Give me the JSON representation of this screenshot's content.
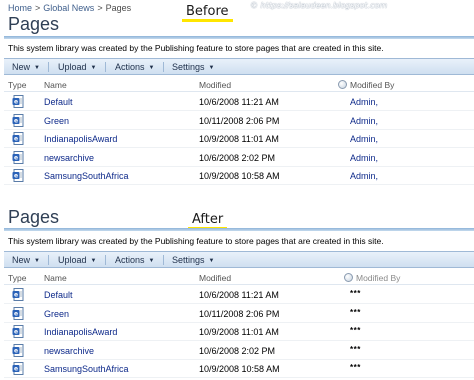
{
  "watermark": "© https://salaudeen.blogspot.com",
  "before": {
    "marker": "Before",
    "breadcrumb": [
      "Home",
      "Global News",
      "Pages"
    ],
    "title": "Pages",
    "description": "This system library was created by the Publishing feature to store pages that are created in this site.",
    "toolbar": {
      "new": "New",
      "upload": "Upload",
      "actions": "Actions",
      "settings": "Settings"
    },
    "columns": {
      "type": "Type",
      "name": "Name",
      "modified": "Modified",
      "modified_by": "Modified By"
    },
    "rows": [
      {
        "name": "Default",
        "modified": "10/6/2008 11:21 AM",
        "modified_by": "Admin,"
      },
      {
        "name": "Green",
        "modified": "10/11/2008 2:06 PM",
        "modified_by": "Admin,"
      },
      {
        "name": "IndianapolisAward",
        "modified": "10/9/2008 11:01 AM",
        "modified_by": "Admin,"
      },
      {
        "name": "newsarchive",
        "modified": "10/6/2008 2:02 PM",
        "modified_by": "Admin,"
      },
      {
        "name": "SamsungSouthAfrica",
        "modified": "10/9/2008 10:58 AM",
        "modified_by": "Admin,"
      }
    ]
  },
  "after": {
    "marker": "After",
    "title": "Pages",
    "description": "This system library was created by the Publishing feature to store pages that are created in this site.",
    "toolbar": {
      "new": "New",
      "upload": "Upload",
      "actions": "Actions",
      "settings": "Settings"
    },
    "columns": {
      "type": "Type",
      "name": "Name",
      "modified": "Modified",
      "modified_by": "Modified By"
    },
    "rows": [
      {
        "name": "Default",
        "modified": "10/6/2008 11:21 AM",
        "modified_by": "***"
      },
      {
        "name": "Green",
        "modified": "10/11/2008 2:06 PM",
        "modified_by": "***"
      },
      {
        "name": "IndianapolisAward",
        "modified": "10/9/2008 11:01 AM",
        "modified_by": "***"
      },
      {
        "name": "newsarchive",
        "modified": "10/6/2008 2:02 PM",
        "modified_by": "***"
      },
      {
        "name": "SamsungSouthAfrica",
        "modified": "10/9/2008 10:58 AM",
        "modified_by": "***"
      }
    ]
  },
  "colors": {
    "link": "#0e2a8a",
    "title": "#2f3f55",
    "toolbar_top": "#e9f1fa",
    "toolbar_bottom": "#cfdff0",
    "highlight": "#ffe600"
  },
  "icons": {
    "page": "aspx-page-icon",
    "modified_by_sort": "presence-icon",
    "dropdown": "chevron-down-icon"
  }
}
